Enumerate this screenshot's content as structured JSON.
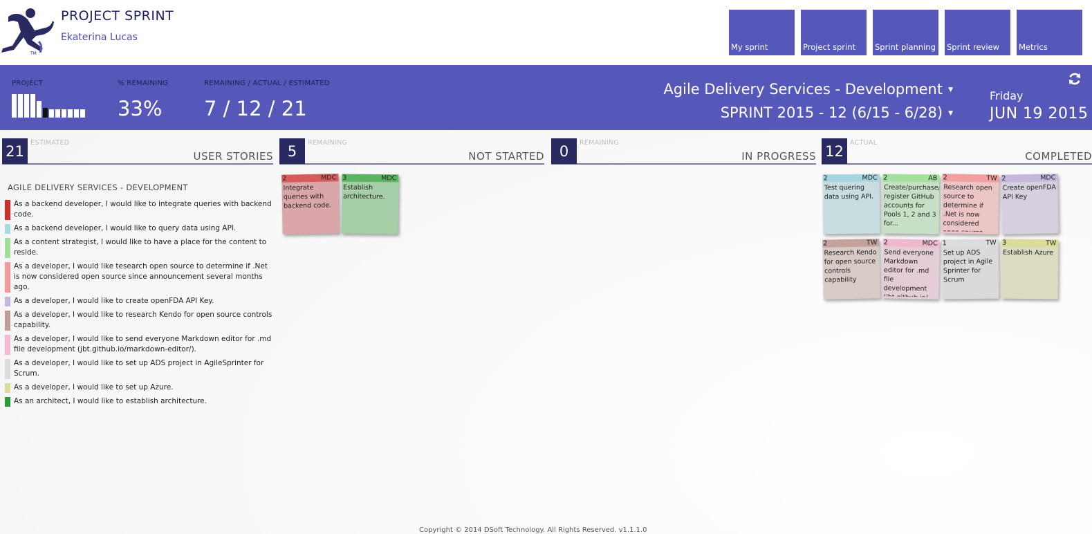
{
  "header": {
    "title": "PROJECT SPRINT",
    "user": "Ekaterina Lucas",
    "logo_icon": "runner-logo-icon",
    "nav": [
      {
        "label": "My sprint"
      },
      {
        "label": "Project sprint"
      },
      {
        "label": "Sprint planning"
      },
      {
        "label": "Sprint review"
      },
      {
        "label": "Metrics"
      }
    ]
  },
  "summary": {
    "project_label": "PROJECT",
    "percent_label": "% REMAINING",
    "percent_value": "33%",
    "ratio_label": "REMAINING / ACTUAL / ESTIMATED",
    "ratio_value": "7 / 12 / 21",
    "project_name": "Agile Delivery Services - Development",
    "sprint_name": "SPRINT 2015 - 12 (6/15 - 6/28)",
    "weekday": "Friday",
    "date": "JUN 19 2015",
    "refresh_icon": "refresh-icon"
  },
  "columns": [
    {
      "count": "21",
      "sub": "ESTIMATED",
      "title": "USER STORIES"
    },
    {
      "count": "5",
      "sub": "REMAINING",
      "title": "NOT STARTED"
    },
    {
      "count": "0",
      "sub": "REMAINING",
      "title": "IN PROGRESS"
    },
    {
      "count": "12",
      "sub": "ACTUAL",
      "title": "COMPLETED"
    }
  ],
  "stories": {
    "heading": "AGILE DELIVERY SERVICES - DEVELOPMENT",
    "items": [
      {
        "text": "As a backend developer, I would like to integrate queries with backend code.",
        "color": "#d42a2a"
      },
      {
        "text": "As a backend developer, I would like to query data using API.",
        "color": "#a8d8e0"
      },
      {
        "text": "As a content strategist, I would like to have a place for the content to reside.",
        "color": "#a2e09a"
      },
      {
        "text": "As a developer, I would like tesearch open source to determine if .Net is now considered open source since announcement several months ago.",
        "color": "#f49a9a"
      },
      {
        "text": "As a developer, I would like to create openFDA API Key.",
        "color": "#c6b8dc"
      },
      {
        "text": "As a developer, I would like to research Kendo for open source controls capability.",
        "color": "#bf9c94"
      },
      {
        "text": "As a developer, I would like to send everyone Markdown editor for .md file development (jbt.github.io/markdown-editor/).",
        "color": "#f4b8d0"
      },
      {
        "text": "As a developer, I would like to set up ADS project in AgileSprinter for Scrum.",
        "color": "#dcdcdc"
      },
      {
        "text": "As a developer, I would like to set up Azure.",
        "color": "#dcdc96"
      },
      {
        "text": "As an architect, I would like to establish architecture.",
        "color": "#2a9e34"
      }
    ]
  },
  "not_started": [
    {
      "points": "2",
      "owner": "MDC",
      "text": "Integrate queries with backend code.",
      "head": "#d65c5c",
      "body": "#dba6a9"
    },
    {
      "points": "3",
      "owner": "MDC",
      "text": "Establish architecture.",
      "head": "#5cb463",
      "body": "#a6cea6"
    }
  ],
  "completed": [
    {
      "points": "2",
      "owner": "MDC",
      "text": "Test quering data using API.",
      "head": "#a8d6e0",
      "body": "#c7dde0"
    },
    {
      "points": "2",
      "owner": "AB",
      "text": "Create/purchase/ register GitHub accounts for Pools 1, 2 and 3 for...",
      "head": "#a6e0a0",
      "body": "#c6e0c6"
    },
    {
      "points": "2",
      "owner": "TW",
      "text": "Research open source to determine if .Net is now considered open source...",
      "head": "#f0a0a0",
      "body": "#ecc6c6"
    },
    {
      "points": "2",
      "owner": "MDC",
      "text": "Create openFDA API Key",
      "head": "#c6b8dc",
      "body": "#d6d0de"
    },
    {
      "points": "2",
      "owner": "TW",
      "text": "Research Kendo for open source controls capability",
      "head": "#c2a29a",
      "body": "#d8cac6"
    },
    {
      "points": "2",
      "owner": "MDC",
      "text": "Send everyone Markdown editor for .md file development (jbt.github.io/...",
      "head": "#f0b8cf",
      "body": "#e4cdd6"
    },
    {
      "points": "1",
      "owner": "TW",
      "text": "Set up ADS project in Agile Sprinter for Scrum",
      "head": "#dcdcdc",
      "body": "#dadada"
    },
    {
      "points": "3",
      "owner": "TW",
      "text": "Establish Azure",
      "head": "#dcdc9a",
      "body": "#dcdcc2"
    }
  ],
  "footer": "Copyright © 2014 DSoft Technology.  All Rights Reserved.  v1.1.1.0"
}
